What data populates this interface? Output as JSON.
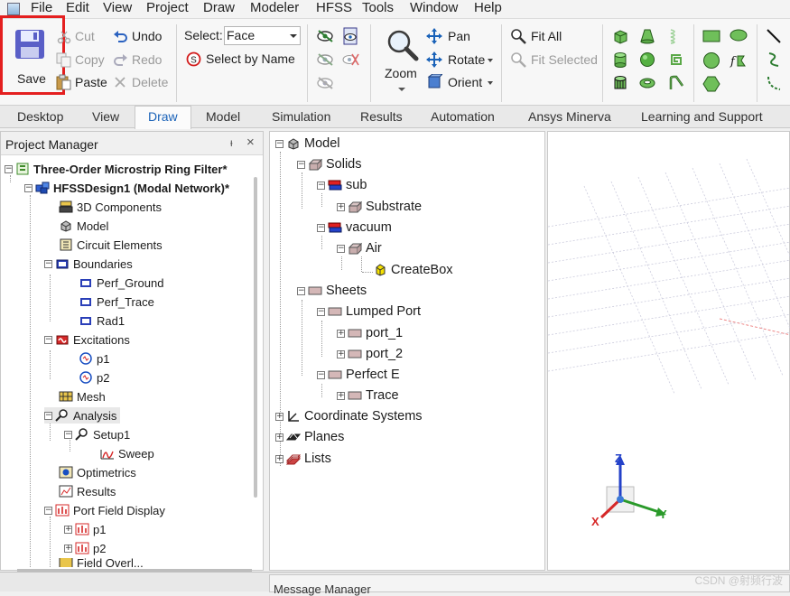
{
  "menu": [
    "File",
    "Edit",
    "View",
    "Project",
    "Draw",
    "Modeler",
    "HFSS",
    "Tools",
    "Window",
    "Help"
  ],
  "ribbon": {
    "save": "Save",
    "cut": "Cut",
    "copy": "Copy",
    "paste": "Paste",
    "undo": "Undo",
    "redo": "Redo",
    "delete": "Delete",
    "select_label": "Select:",
    "select_value": "Face",
    "select_by_name": "Select by Name",
    "zoom": "Zoom",
    "pan": "Pan",
    "rotate": "Rotate",
    "orient": "Orient",
    "fit_all": "Fit All",
    "fit_selected": "Fit Selected"
  },
  "tabs": [
    "Desktop",
    "View",
    "Draw",
    "Model",
    "Simulation",
    "Results",
    "Automation",
    "Ansys Minerva",
    "Learning and Support"
  ],
  "active_tab": "Draw",
  "project_manager": {
    "title": "Project Manager",
    "pin": "ᵻ",
    "close": "×",
    "project": "Three-Order Microstrip Ring Filter*",
    "design": "HFSSDesign1 (Modal Network)*",
    "items": {
      "components": "3D Components",
      "model": "Model",
      "circuit": "Circuit Elements",
      "boundaries": "Boundaries",
      "perf_ground": "Perf_Ground",
      "perf_trace": "Perf_Trace",
      "rad1": "Rad1",
      "excitations": "Excitations",
      "p1": "p1",
      "p2": "p2",
      "mesh": "Mesh",
      "analysis": "Analysis",
      "setup1": "Setup1",
      "sweep": "Sweep",
      "optimetrics": "Optimetrics",
      "results": "Results",
      "port_field": "Port Field Display",
      "pf_p1": "p1",
      "pf_p2": "p2",
      "field_overlays": "Field Overl..."
    }
  },
  "model_tree": {
    "model": "Model",
    "solids": "Solids",
    "sub": "sub",
    "substrate": "Substrate",
    "vacuum": "vacuum",
    "air": "Air",
    "createbox": "CreateBox",
    "sheets": "Sheets",
    "lumped_port": "Lumped Port",
    "port_1": "port_1",
    "port_2": "port_2",
    "perfect_e": "Perfect E",
    "trace": "Trace",
    "coord": "Coordinate Systems",
    "planes": "Planes",
    "lists": "Lists"
  },
  "axes": {
    "x": "X",
    "y": "Y",
    "z": "Z"
  },
  "bottom_label": "Message Manager",
  "watermark": "CSDN @射频行波",
  "colors": {
    "accent": "#1a62b8",
    "highlight": "#e41f1f",
    "grid": "#c8c8dc"
  }
}
